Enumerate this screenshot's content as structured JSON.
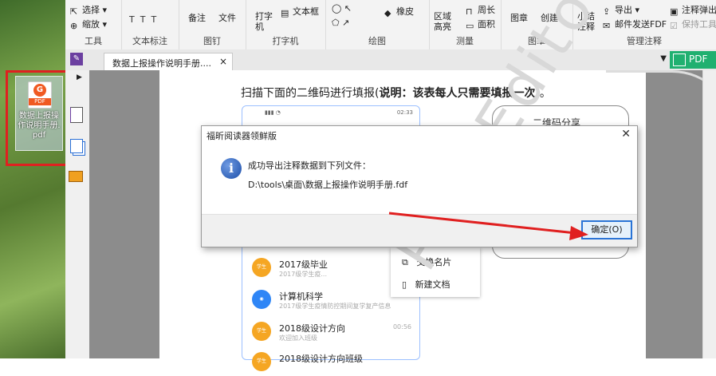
{
  "desktop": {
    "icon_label": "数据上报操作说明手册.pdf",
    "icon_badge": "PDF",
    "icon_glyph": "G"
  },
  "ribbon": {
    "groups": [
      {
        "label": "工具",
        "items": [
          "选择",
          "缩放"
        ]
      },
      {
        "label": "文本标注",
        "items": [
          "T",
          "T",
          "T"
        ]
      },
      {
        "label": "图钉",
        "items": [
          "备注",
          "文件"
        ]
      },
      {
        "label": "打字机",
        "items": [
          "打字机",
          "文本框"
        ]
      },
      {
        "label": "绘图",
        "items": [
          "橡皮"
        ]
      },
      {
        "label": "测量",
        "items": [
          "区域高亮",
          "周长",
          "面积"
        ]
      },
      {
        "label": "图章",
        "items": [
          "图章",
          "创建"
        ]
      },
      {
        "label": "管理注释",
        "items": [
          "小结注释",
          "导出",
          "邮件发送FDF",
          "注释弹出",
          "保持工具"
        ]
      }
    ]
  },
  "tab": {
    "title": "数据上报操作说明手册....",
    "close": "×"
  },
  "pdf_button": "PDF",
  "page": {
    "heading_start": "扫描下面的二维码进行填报(",
    "heading_bold": "说明：该表每人只需要填报一次",
    "heading_end": ")。",
    "qr_label": "二维码分享",
    "status_time": "02:33",
    "popup_items": [
      "交换名片",
      "新建文档"
    ],
    "list": [
      {
        "name": "2017级毕业",
        "sub": "2017级学生疫...",
        "badge": "学生",
        "color": "#f5a623"
      },
      {
        "name": "计算机科学",
        "sub": "2017级学生疫情防控期间复学复产信息",
        "badge": "",
        "color": "#2f86f6"
      },
      {
        "name": "2018级设计方向",
        "sub": "欢迎加入班级",
        "badge": "学生",
        "time": "00:56",
        "color": "#f5a623"
      },
      {
        "name": "2018级设计方向班级",
        "sub": "",
        "badge": "学生",
        "color": "#f5a623"
      }
    ],
    "watermark": "PDF Editor"
  },
  "dialog": {
    "title": "福昕阅读器领鲜版",
    "close": "✕",
    "message": "成功导出注释数据到下列文件：",
    "path": "D:\\tools\\桌面\\数据上报操作说明手册.fdf",
    "ok_label": "确定(O)",
    "info_glyph": "i"
  },
  "colors": {
    "annotation_red": "#e02020",
    "ok_border": "#2a74d6",
    "pdf_green": "#20b070"
  }
}
